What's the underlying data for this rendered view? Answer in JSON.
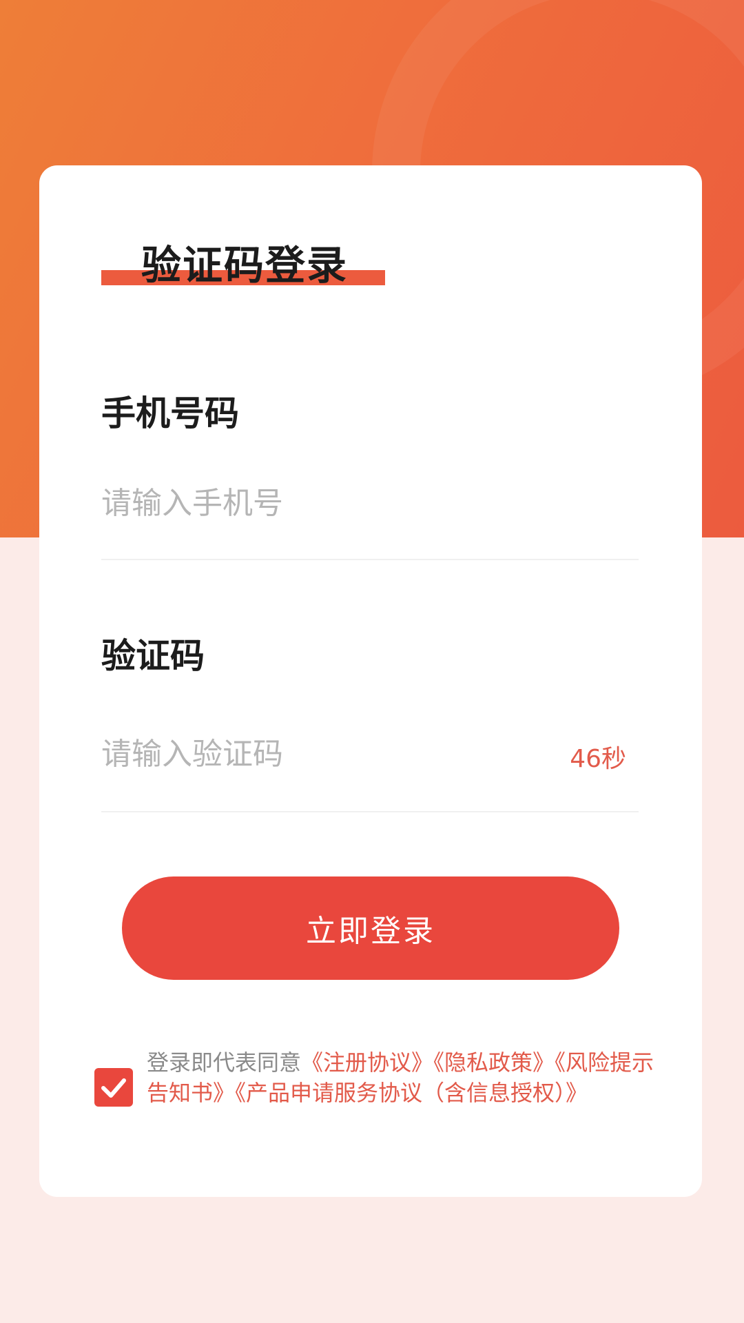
{
  "login": {
    "title": "验证码登录",
    "phone_label": "手机号码",
    "phone_placeholder": "请输入手机号",
    "code_label": "验证码",
    "code_placeholder": "请输入验证码",
    "countdown": "46秒",
    "submit_label": "立即登录"
  },
  "agreement": {
    "checked": true,
    "prefix": "登录即代表同意",
    "links": [
      "《注册协议》",
      "《隐私政策》",
      "《风险提示告知书》",
      "《产品申请服务协议（含信息授权）》"
    ]
  },
  "colors": {
    "brand": "#e9473d",
    "hero_start": "#ee7e38",
    "hero_end": "#ec5b3e",
    "background": "#fcebe8"
  }
}
